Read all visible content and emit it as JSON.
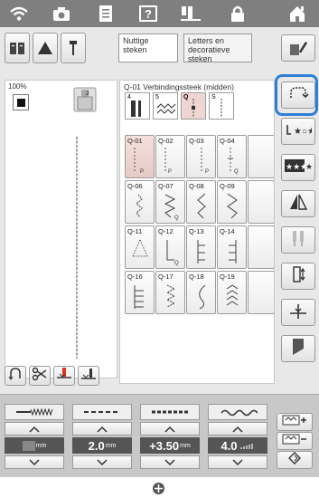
{
  "colors": {
    "accent_highlight": "#2e7fd6",
    "statusbar": "#7f7f7f",
    "selected_cell": "#f0d6d2"
  },
  "statusbar": {
    "icons": [
      "wifi-icon",
      "camera-icon",
      "document-icon",
      "help-icon",
      "needle-mode-icon",
      "lock-icon",
      "home-icon"
    ]
  },
  "categories": {
    "utility": "Nuttige\nsteken",
    "letters": "Letters en\ndecoratieve\nsteken"
  },
  "preview": {
    "zoom": "100%"
  },
  "stitch_grid": {
    "title": "Q-01 Verbindingssteek (midden)",
    "recent": [
      "4",
      "5",
      "Q",
      "S"
    ],
    "rows": [
      [
        "Q-01",
        "Q-02",
        "Q-03",
        "Q-04"
      ],
      [
        "Q-06",
        "Q-07",
        "Q-08",
        "Q-09"
      ],
      [
        "Q-11",
        "Q-12",
        "Q-13",
        "Q-14"
      ],
      [
        "Q-16",
        "Q-17",
        "Q-18",
        "Q-19"
      ]
    ],
    "selected": "Q-01",
    "glyph_letters": {
      "Q-01": "P",
      "Q-02": "P",
      "Q-03": "P",
      "Q-04": "Q",
      "Q-07": "Q",
      "Q-12": "Q"
    }
  },
  "sidebar": {
    "items": [
      "stitch-connect-icon",
      "pattern-mirror-icon",
      "stars-pattern-icon",
      "mirror-icon",
      "twin-needle-icon",
      "needle-position-icon",
      "elongation-icon",
      "bobbin-icon"
    ]
  },
  "settings": {
    "width": {
      "value": "",
      "unit": "mm"
    },
    "length": {
      "value": "2.0",
      "unit": "mm"
    },
    "l_r_shift": {
      "value": "+3.50",
      "unit": "mm"
    },
    "tension": {
      "value": "4.0"
    }
  }
}
